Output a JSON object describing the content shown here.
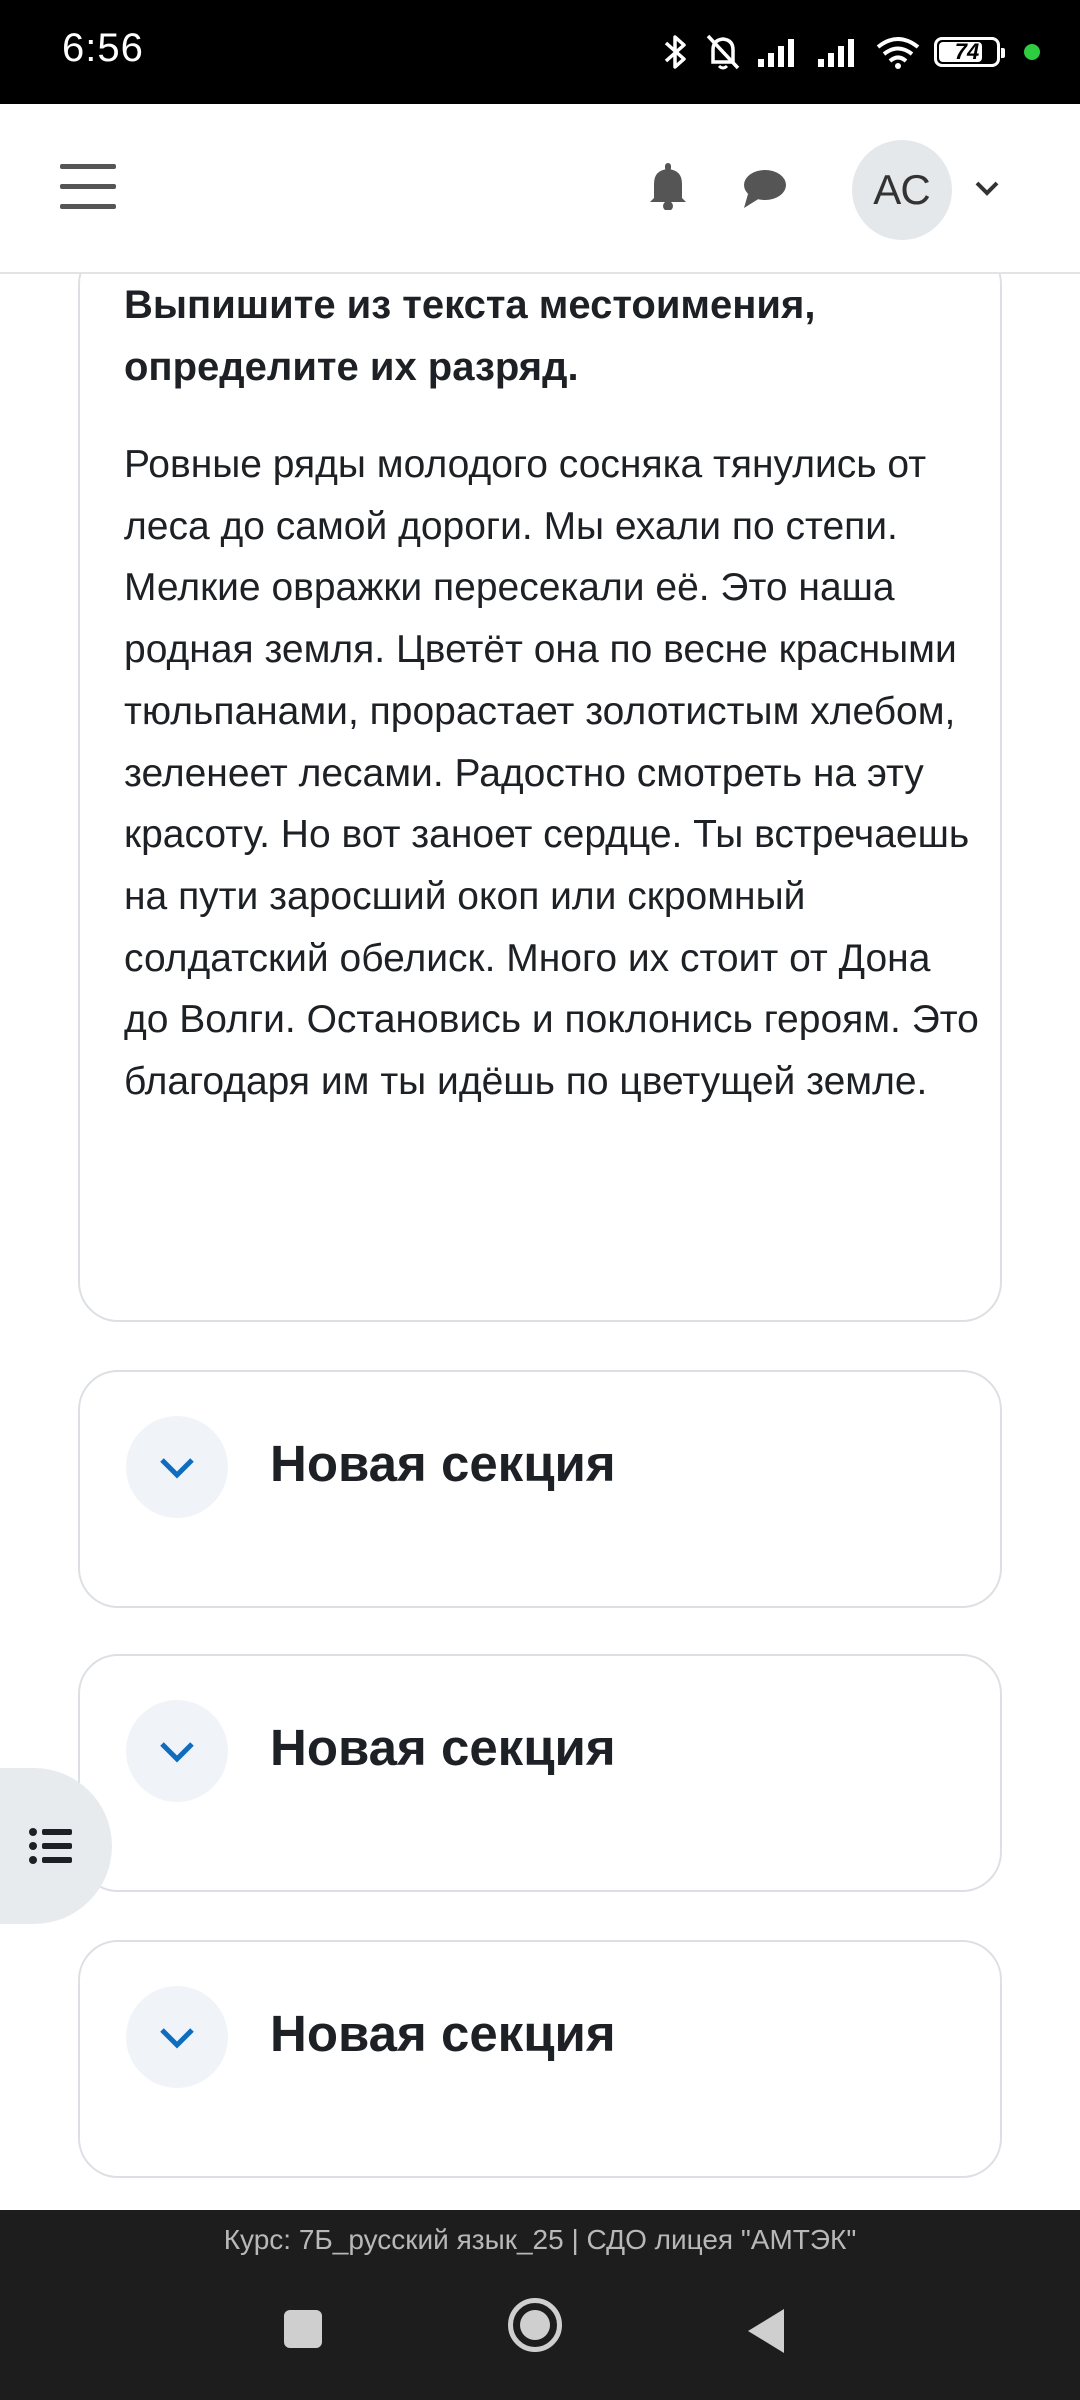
{
  "status_bar": {
    "time": "6:56",
    "battery": "74"
  },
  "header": {
    "avatar_initials": "АС"
  },
  "task": {
    "title": "Выпишите из текста местоимения, определите их разряд.",
    "body": "Ровные ряды молодого сосняка тянулись от леса до самой дороги. Мы ехали по степи. Мелкие овражки пересекали её. Это наша родная земля. Цветёт она по весне красными тюльпанами, прорастает золотистым хлебом, зеленеет лесами. Радостно смотреть на эту красоту. Но вот заноет сердце. Ты встречаешь на пути заросший окоп или скромный солдатский обелиск. Много их стоит от Дона до Волги. Остановись и поклонись героям. Это благодаря им ты идёшь по цветущей земле."
  },
  "sections": [
    {
      "title": "Новая секция"
    },
    {
      "title": "Новая секция"
    },
    {
      "title": "Новая секция"
    }
  ],
  "footer": {
    "text": "Курс: 7Б_русский язык_25 | СДО лицея \"АМТЭК\""
  },
  "colors": {
    "accent": "#0f6cbf",
    "text": "#1d2125",
    "border": "#dcdfe3"
  }
}
